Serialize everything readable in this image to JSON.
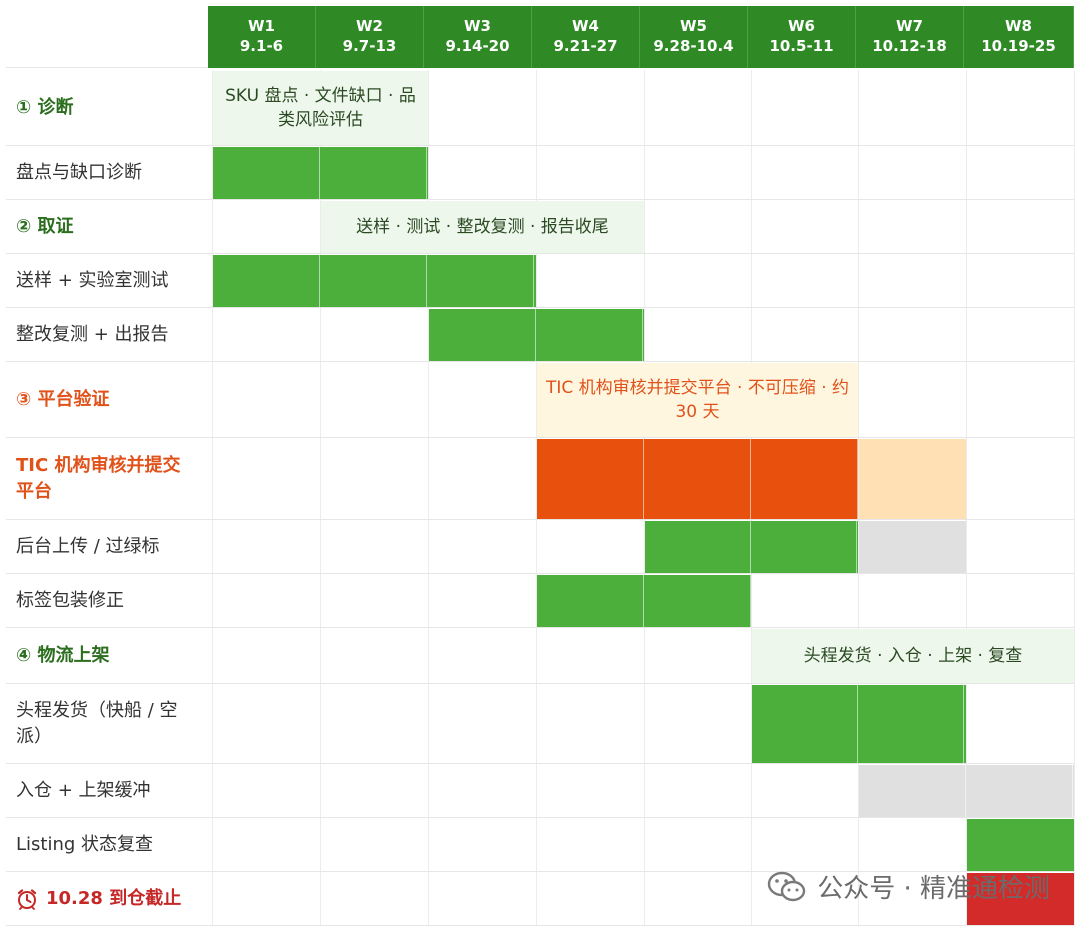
{
  "weeks": [
    {
      "label": "W1",
      "dates": "9.1-6"
    },
    {
      "label": "W2",
      "dates": "9.7-13"
    },
    {
      "label": "W3",
      "dates": "9.14-20"
    },
    {
      "label": "W4",
      "dates": "9.21-27"
    },
    {
      "label": "W5",
      "dates": "9.28-10.4"
    },
    {
      "label": "W6",
      "dates": "10.5-11"
    },
    {
      "label": "W7",
      "dates": "10.12-18"
    },
    {
      "label": "W8",
      "dates": "10.19-25"
    }
  ],
  "colors": {
    "green": "#4caf3c",
    "orange": "#e8500e",
    "peach": "#ffe0b5",
    "gray": "#e0e0e0",
    "red": "#d32a2a",
    "note_green_bg": "#eef7ec",
    "note_orange_bg": "#fff6e0",
    "phase_green": "#2a6e1e",
    "phase_orange": "#e0521a",
    "deadline_red": "#c62828"
  },
  "rows": [
    {
      "label": "① 诊断",
      "kind": "phase",
      "color": "#2a6e1e",
      "note": {
        "text": "SKU 盘点 · 文件缺口 · 品类风险评估",
        "start": 1,
        "end": 2,
        "style": "green"
      }
    },
    {
      "label": "盘点与缺口诊断",
      "kind": "task",
      "bars": [
        {
          "start": 1,
          "end": 2,
          "color": "green"
        }
      ]
    },
    {
      "label": "② 取证",
      "kind": "phase",
      "color": "#2a6e1e",
      "note": {
        "text": "送样 · 测试 · 整改复测 · 报告收尾",
        "start": 2,
        "end": 4,
        "style": "green"
      }
    },
    {
      "label": "送样 + 实验室测试",
      "kind": "task",
      "bars": [
        {
          "start": 1,
          "end": 3,
          "color": "green"
        }
      ]
    },
    {
      "label": "整改复测 + 出报告",
      "kind": "task",
      "bars": [
        {
          "start": 3,
          "end": 4,
          "color": "green"
        }
      ]
    },
    {
      "label": "③ 平台验证",
      "kind": "phase",
      "color": "#e0521a",
      "note": {
        "text": "TIC 机构审核并提交平台 · 不可压缩 · 约 30 天",
        "start": 4,
        "end": 6,
        "style": "orange"
      }
    },
    {
      "label": "TIC 机构审核并提交平台",
      "kind": "task-bold",
      "color": "#e0521a",
      "bars": [
        {
          "start": 4,
          "end": 6,
          "color": "orange"
        },
        {
          "start": 7,
          "end": 7,
          "color": "peach"
        }
      ]
    },
    {
      "label": "后台上传 / 过绿标",
      "kind": "task",
      "bars": [
        {
          "start": 5,
          "end": 6,
          "color": "green"
        },
        {
          "start": 7,
          "end": 7,
          "color": "gray"
        }
      ]
    },
    {
      "label": "标签包装修正",
      "kind": "task",
      "bars": [
        {
          "start": 4,
          "end": 5,
          "color": "green"
        }
      ]
    },
    {
      "label": "④ 物流上架",
      "kind": "phase",
      "color": "#2a6e1e",
      "note": {
        "text": "头程发货 · 入仓 · 上架 · 复查",
        "start": 6,
        "end": 8,
        "style": "green"
      }
    },
    {
      "label": "头程发货（快船 / 空派）",
      "kind": "task",
      "bars": [
        {
          "start": 6,
          "end": 7,
          "color": "green"
        }
      ]
    },
    {
      "label": "入仓 + 上架缓冲",
      "kind": "task",
      "bars": [
        {
          "start": 7,
          "end": 8,
          "color": "gray"
        }
      ]
    },
    {
      "label": "Listing 状态复查",
      "kind": "task",
      "bars": [
        {
          "start": 8,
          "end": 8,
          "color": "green"
        }
      ]
    },
    {
      "label": "10.28 到仓截止",
      "kind": "deadline",
      "color": "#c62828",
      "icon": "alarm-clock-icon",
      "bars": [
        {
          "start": 8,
          "end": 8,
          "color": "red"
        }
      ]
    }
  ],
  "watermark": {
    "text": "公众号 · 精准通检测",
    "icon": "wechat-icon"
  }
}
